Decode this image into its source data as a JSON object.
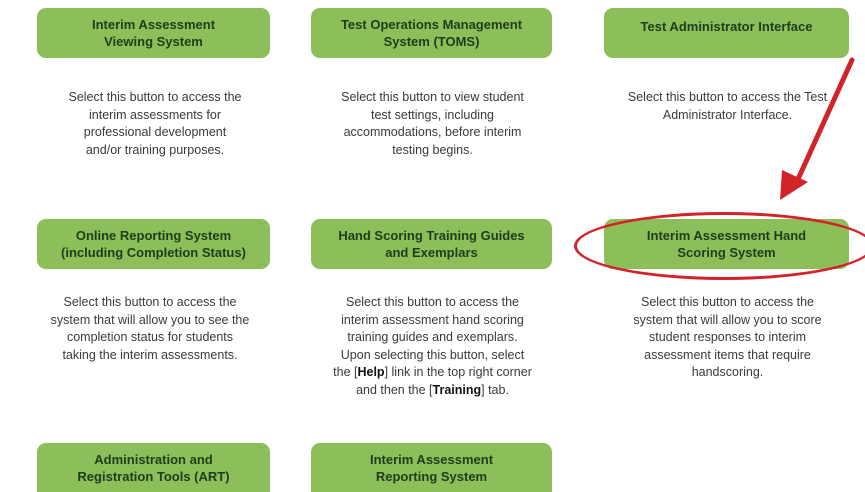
{
  "tiles": [
    {
      "button": [
        "Interim Assessment",
        "Viewing System"
      ],
      "desc": [
        "Select this button to access the",
        "interim assessments for",
        "professional development",
        "and/or training purposes."
      ]
    },
    {
      "button": [
        "Test Operations Management",
        "System (TOMS)"
      ],
      "desc": [
        "Select this button to view student",
        "test settings, including",
        "accommodations, before interim",
        "testing begins."
      ]
    },
    {
      "button": [
        "Test Administrator Interface"
      ],
      "desc": [
        "Select this button to access the Test",
        "Administrator Interface."
      ]
    },
    {
      "button": [
        "Online Reporting System",
        "(including Completion Status)"
      ],
      "desc": [
        "Select this button to access the",
        "system that will allow you to see the",
        "completion status for students",
        "taking the interim assessments."
      ]
    },
    {
      "button": [
        "Hand Scoring Training Guides",
        "and Exemplars"
      ],
      "desc": [
        "Select this button to access the",
        "interim assessment hand scoring",
        "training guides and exemplars.",
        "Upon selecting this button, select"
      ],
      "desc_rich": {
        "line5_pre": "the [",
        "line5_bold": "Help",
        "line5_post": "] link in the top right corner",
        "line6_pre": "and then the [",
        "line6_bold": "Training",
        "line6_post": "] tab."
      }
    },
    {
      "button": [
        "Interim Assessment Hand",
        "Scoring System"
      ],
      "desc": [
        "Select this button to access the",
        "system that will allow you to score",
        "student responses to interim",
        "assessment items that require",
        "handscoring."
      ]
    },
    {
      "button": [
        "Administration and",
        "Registration Tools (ART)"
      ],
      "desc": []
    },
    {
      "button": [
        "Interim Assessment",
        "Reporting System"
      ],
      "desc": []
    }
  ],
  "colors": {
    "button_bg": "#8cbe5a",
    "annotation_red": "#d2232a"
  },
  "annotation": {
    "arrow_icon": "red-arrow-icon",
    "circle": "red-ellipse-highlight"
  }
}
